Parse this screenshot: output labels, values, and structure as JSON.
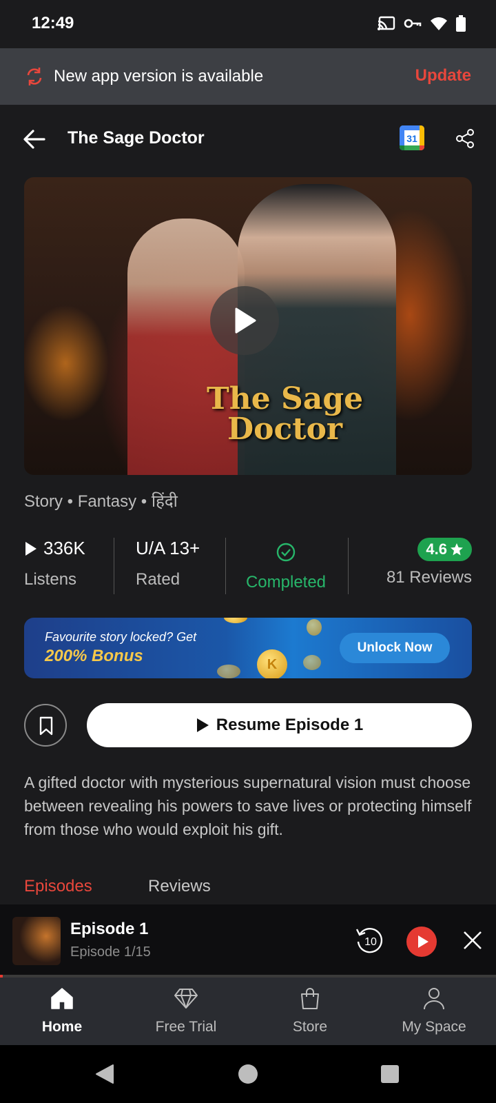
{
  "status_bar": {
    "time": "12:49"
  },
  "update_banner": {
    "text": "New app version is available",
    "action": "Update"
  },
  "header": {
    "title": "The Sage Doctor",
    "calendar_day": "31"
  },
  "poster": {
    "title_line1": "The Sage",
    "title_line2": "Doctor"
  },
  "tags": "Story • Fantasy • हिंदी",
  "stats": {
    "listens_value": "336K",
    "listens_label": "Listens",
    "rating_value": "U/A 13+",
    "rating_label": "Rated",
    "status_label": "Completed",
    "score": "4.6",
    "reviews_label": "81 Reviews"
  },
  "promo": {
    "line1": "Favourite story locked?  Get",
    "line2": "200% Bonus",
    "coin_letter": "K",
    "button": "Unlock Now"
  },
  "actions": {
    "resume": "Resume Episode 1"
  },
  "description": "A gifted doctor with mysterious supernatural vision must choose between revealing his powers to save lives or protecting himself from those who would exploit his gift.",
  "tabs": {
    "episodes": "Episodes",
    "reviews": "Reviews"
  },
  "mini_player": {
    "title": "Episode 1",
    "subtitle": "Episode 1/15",
    "rewind_seconds": "10",
    "progress": 0.005
  },
  "bottom_nav": {
    "home": "Home",
    "free_trial": "Free Trial",
    "store": "Store",
    "my_space": "My Space"
  },
  "colors": {
    "accent": "#e8473c",
    "success": "#27b66a",
    "rating": "#1ea24f"
  }
}
